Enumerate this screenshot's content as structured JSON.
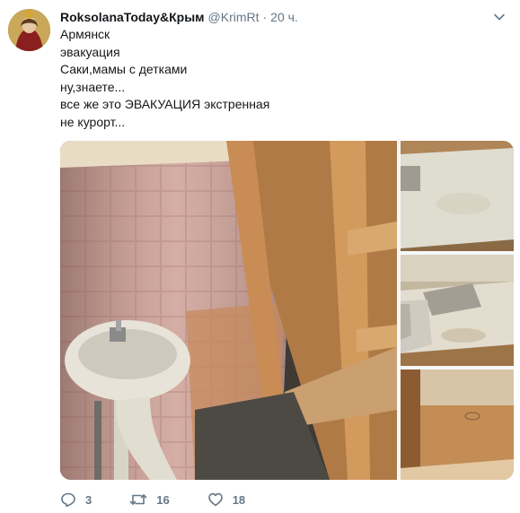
{
  "author": {
    "name": "RoksolanaToday&Крым",
    "handle": "@KrimRt",
    "separator": "·",
    "timestamp": "20 ч."
  },
  "tweet": {
    "lines": [
      "Армянск",
      "эвакуация",
      "Саки,мамы с детками",
      "ну,знаете...",
      "все же это ЭВАКУАЦИЯ экстренная",
      "не курорт..."
    ]
  },
  "media": {
    "photos": [
      {
        "content": "bathroom with tiled wall, sink and wooden shelving"
      },
      {
        "content": "bed with stained mattress"
      },
      {
        "content": "mattress with pillows"
      },
      {
        "content": "empty wooden shelf"
      }
    ]
  },
  "actions": {
    "reply_count": "3",
    "retweet_count": "16",
    "like_count": "18"
  },
  "icons": {
    "caret": "chevron-down-icon",
    "reply": "reply-icon",
    "retweet": "retweet-icon",
    "like": "heart-icon"
  },
  "colors": {
    "text": "#14171a",
    "secondary": "#657786"
  }
}
